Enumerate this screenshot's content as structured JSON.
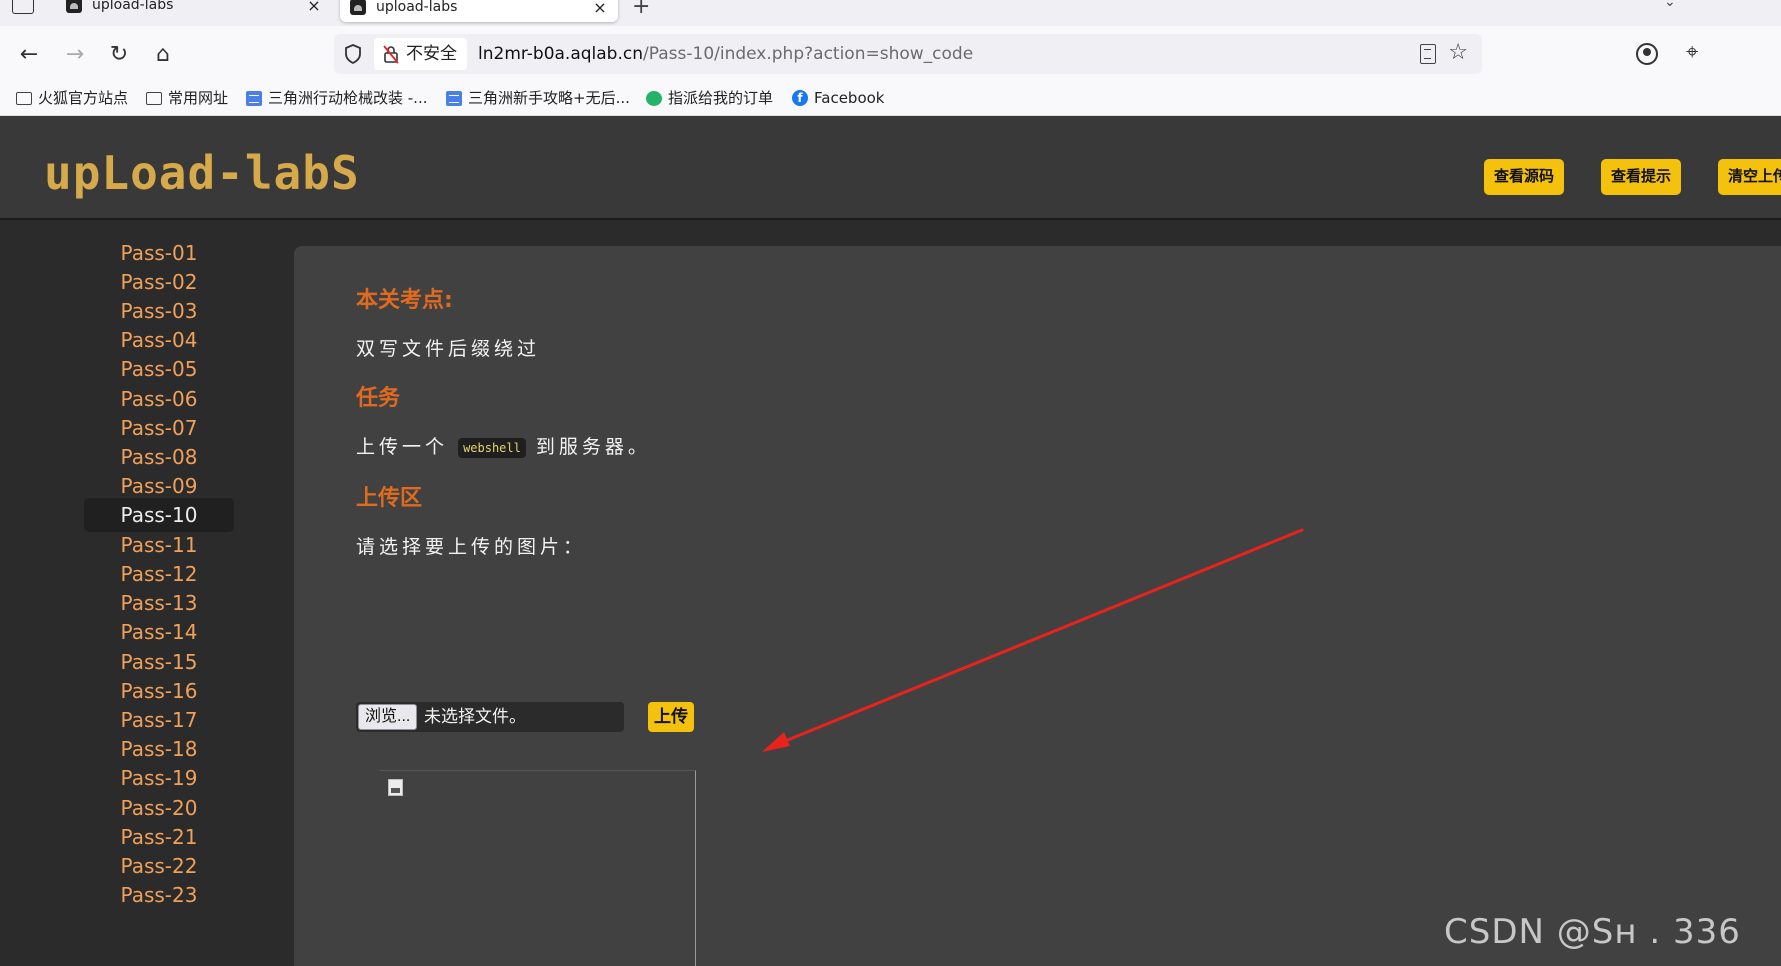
{
  "browser": {
    "tabs": [
      {
        "title": "upload-labs",
        "active": false
      },
      {
        "title": "upload-labs",
        "active": true
      }
    ],
    "new_tab": "+",
    "close_glyph": "×",
    "address": {
      "security_label": "不安全",
      "url_host": "ln2mr-b0a.aqlab.cn",
      "url_path": "/Pass-10/index.php?action=show_code"
    },
    "bookmarks": [
      {
        "label": "火狐官方站点",
        "icon": "folder-icon"
      },
      {
        "label": "常用网址",
        "icon": "folder-icon"
      },
      {
        "label": "三角洲行动枪械改装 -...",
        "icon": "doc-icon"
      },
      {
        "label": "三角洲新手攻略+无后...",
        "icon": "doc-icon"
      },
      {
        "label": "指派给我的订单",
        "icon": "green-icon"
      },
      {
        "label": "Facebook",
        "icon": "facebook-icon"
      }
    ]
  },
  "header": {
    "logo": "upLoad-labS",
    "buttons": [
      "查看源码",
      "查看提示",
      "清空上传"
    ]
  },
  "sidebar": {
    "items": [
      "Pass-01",
      "Pass-02",
      "Pass-03",
      "Pass-04",
      "Pass-05",
      "Pass-06",
      "Pass-07",
      "Pass-08",
      "Pass-09",
      "Pass-10",
      "Pass-11",
      "Pass-12",
      "Pass-13",
      "Pass-14",
      "Pass-15",
      "Pass-16",
      "Pass-17",
      "Pass-18",
      "Pass-19",
      "Pass-20",
      "Pass-21",
      "Pass-22",
      "Pass-23"
    ],
    "active": "Pass-10"
  },
  "main": {
    "focus_title": "本关考点:",
    "focus_text": "双写文件后缀绕过",
    "task_title": "任务",
    "task_before": "上传一个",
    "task_code": "webshell",
    "task_after": "到服务器。",
    "upload_title": "上传区",
    "upload_prompt": "请选择要上传的图片：",
    "browse_label": "浏览...",
    "file_status": "未选择文件。",
    "upload_label": "上传"
  },
  "watermark": "CSDN @Sн    . 336",
  "colors": {
    "accent_yellow": "#f4c20d",
    "section_orange": "#e06a1f",
    "sidebar_link": "#f0a05a",
    "logo_gold": "#d6a94a",
    "annotation_arrow": "#e8231d"
  }
}
